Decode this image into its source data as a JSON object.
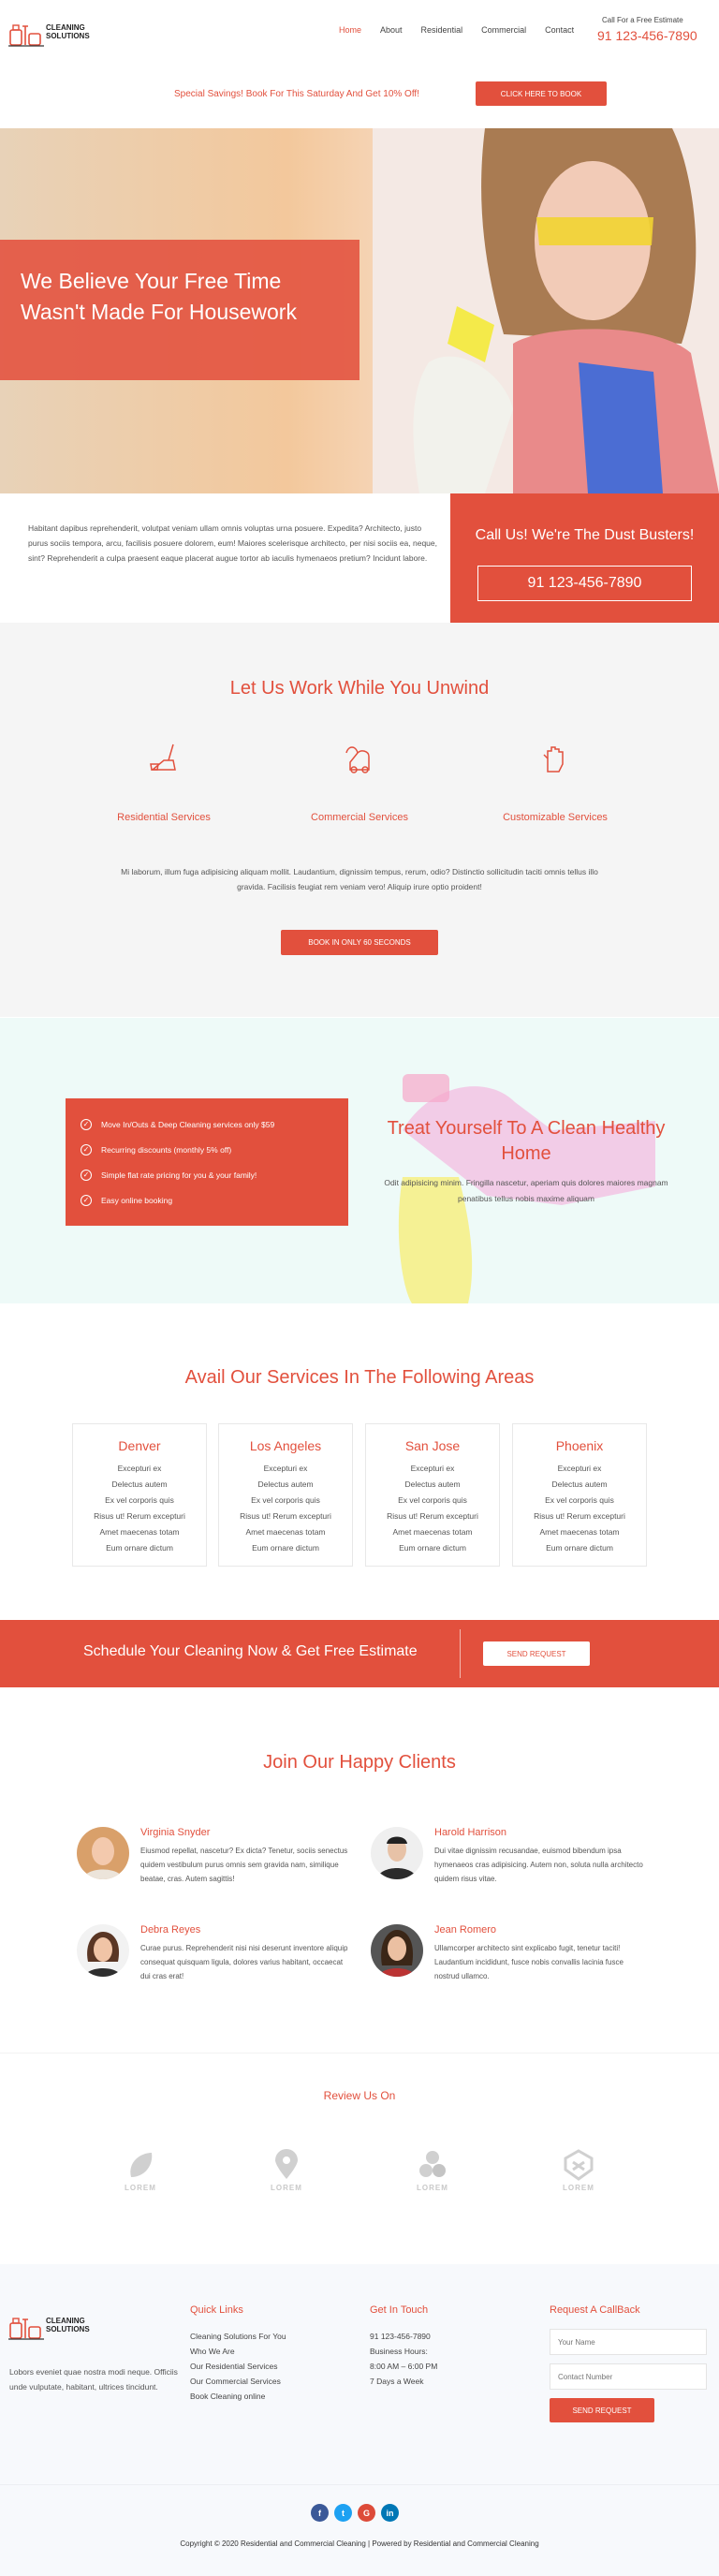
{
  "header": {
    "logo_line1": "CLEANING",
    "logo_line2": "SOLUTIONS",
    "nav": [
      "Home",
      "About",
      "Residential",
      "Commercial",
      "Contact"
    ],
    "call_label": "Call For a Free Estimate",
    "call_number": "91 123-456-7890"
  },
  "promo": {
    "text": "Special Savings! Book For This Saturday And Get 10% Off!",
    "button": "CLICK HERE TO BOOK"
  },
  "hero": {
    "headline": "We Believe Your Free Time Wasn't Made For Housework"
  },
  "intro": {
    "text": "Habitant dapibus reprehenderit, volutpat veniam ullam omnis voluptas urna posuere. Expedita? Architecto, justo purus sociis tempora, arcu, facilisis posuere dolorem, eum! Maiores scelerisque architecto, per nisi sociis ea, neque, sint? Reprehenderit a culpa praesent eaque placerat augue tortor ab iaculis hymenaeos pretium? Incidunt labore.",
    "call_heading": "Call Us! We're The Dust Busters!",
    "call_number": "91 123-456-7890"
  },
  "services": {
    "title": "Let Us Work While You Unwind",
    "items": [
      "Residential Services",
      "Commercial Services",
      "Customizable Services"
    ],
    "text": "Mi laborum, illum fuga adipisicing aliquam mollit. Laudantium, dignissim tempus, rerum, odio? Distinctio sollicitudin taciti omnis tellus illo gravida. Facilisis feugiat rem veniam vero! Aliquip irure optio proident!",
    "button": "BOOK IN ONLY 60 SECONDS"
  },
  "treat": {
    "list": [
      "Move In/Outs & Deep Cleaning services only $59",
      "Recurring discounts (monthly 5% off)",
      "Simple flat rate pricing for you & your family!",
      "Easy online booking"
    ],
    "title": "Treat Yourself To A Clean Healthy Home",
    "text": "Odit adipisicing minim. Fringilla nascetur, aperiam quis dolores maiores magnam penatibus tellus nobis maxime aliquam"
  },
  "areas": {
    "title": "Avail Our Services In The Following Areas",
    "cities": [
      {
        "name": "Denver",
        "rows": [
          "Excepturi ex",
          "Delectus autem",
          "Ex vel corporis quis",
          "Risus ut! Rerum excepturi",
          "Amet maecenas totam",
          "Eum ornare dictum"
        ]
      },
      {
        "name": "Los Angeles",
        "rows": [
          "Excepturi ex",
          "Delectus autem",
          "Ex vel corporis quis",
          "Risus ut! Rerum excepturi",
          "Amet maecenas totam",
          "Eum ornare dictum"
        ]
      },
      {
        "name": "San Jose",
        "rows": [
          "Excepturi ex",
          "Delectus autem",
          "Ex vel corporis quis",
          "Risus ut! Rerum excepturi",
          "Amet maecenas totam",
          "Eum ornare dictum"
        ]
      },
      {
        "name": "Phoenix",
        "rows": [
          "Excepturi ex",
          "Delectus autem",
          "Ex vel corporis quis",
          "Risus ut! Rerum excepturi",
          "Amet maecenas totam",
          "Eum ornare dictum"
        ]
      }
    ]
  },
  "schedule": {
    "text": "Schedule Your Cleaning Now & Get Free Estimate",
    "button": "SEND REQUEST"
  },
  "clients": {
    "title": "Join Our Happy Clients",
    "items": [
      {
        "name": "Virginia Snyder",
        "text": "Eiusmod repellat, nascetur? Ex dicta? Tenetur, sociis senectus quidem vestibulum purus omnis sem gravida nam, similique beatae, cras. Autem sagittis!"
      },
      {
        "name": "Harold Harrison",
        "text": "Dui vitae dignissim recusandae, euismod bibendum ipsa hymenaeos cras adipisicing. Autem non, soluta nulla architecto quidem risus vitae."
      },
      {
        "name": "Debra Reyes",
        "text": "Curae purus. Reprehenderit nisi nisi deserunt inventore aliquip consequat quisquam ligula, dolores varius habitant, occaecat dui cras erat!"
      },
      {
        "name": "Jean Romero",
        "text": "Ullamcorper architecto sint explicabo fugit, tenetur taciti! Laudantium incididunt, fusce nobis convallis lacinia fusce nostrud ullamco."
      }
    ]
  },
  "review": {
    "title": "Review Us On",
    "logos": [
      "LOREM",
      "LOREM",
      "LOREM",
      "LOREM"
    ]
  },
  "footer": {
    "about": "Lobors eveniet quae nostra modi neque. Officiis unde vulputate, habitant, ultrices tincidunt.",
    "quick_links_title": "Quick Links",
    "quick_links": [
      "Cleaning Solutions For You",
      "Who We Are",
      "Our Residential Services",
      "Our Commercial Services",
      "Book Cleaning online"
    ],
    "touch_title": "Get In Touch",
    "touch": [
      "91 123-456-7890",
      "Business Hours:",
      "8:00 AM – 6:00 PM",
      "7 Days a Week"
    ],
    "callback_title": "Request A CallBack",
    "name_placeholder": "Your Name",
    "contact_placeholder": "Contact Number",
    "callback_button": "SEND REQUEST"
  },
  "copyright": "Copyright © 2020 Residential and Commercial Cleaning | Powered by Residential and Commercial Cleaning",
  "colors": {
    "accent": "#e2503d",
    "facebook": "#3b5998",
    "twitter": "#1da1f2",
    "google": "#dd4b39",
    "linkedin": "#0077b5"
  }
}
